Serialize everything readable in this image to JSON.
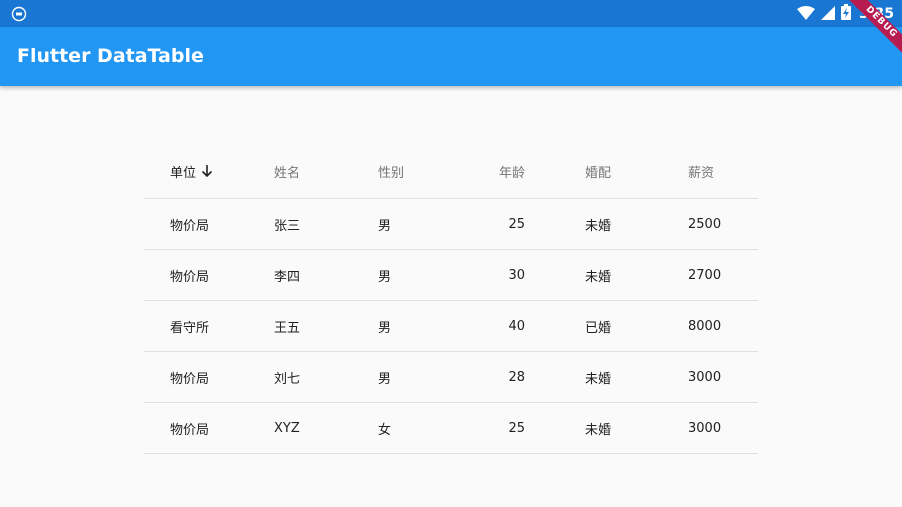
{
  "status_bar": {
    "time": "3:35",
    "icons": [
      "flutter-notification-icon",
      "wifi-icon",
      "cellular-signal-icon",
      "battery-charging-icon"
    ]
  },
  "app_bar": {
    "title": "Flutter DataTable"
  },
  "debug_banner": {
    "label": "DEBUG"
  },
  "table": {
    "sort_column": 0,
    "sort_direction": "descending",
    "columns": [
      "单位",
      "姓名",
      "性别",
      "年龄",
      "婚配",
      "薪资"
    ],
    "rows": [
      [
        "物价局",
        "张三",
        "男",
        "25",
        "未婚",
        "2500"
      ],
      [
        "物价局",
        "李四",
        "男",
        "30",
        "未婚",
        "2700"
      ],
      [
        "看守所",
        "王五",
        "男",
        "40",
        "已婚",
        "8000"
      ],
      [
        "物价局",
        "刘七",
        "男",
        "28",
        "未婚",
        "3000"
      ],
      [
        "物价局",
        "XYZ",
        "女",
        "25",
        "未婚",
        "3000"
      ]
    ]
  },
  "colors": {
    "status_bar": "#1976d2",
    "app_bar": "#2196f3",
    "background": "#fafafa",
    "divider": "#e0e0e0",
    "debug_ribbon": "#b71c50"
  }
}
